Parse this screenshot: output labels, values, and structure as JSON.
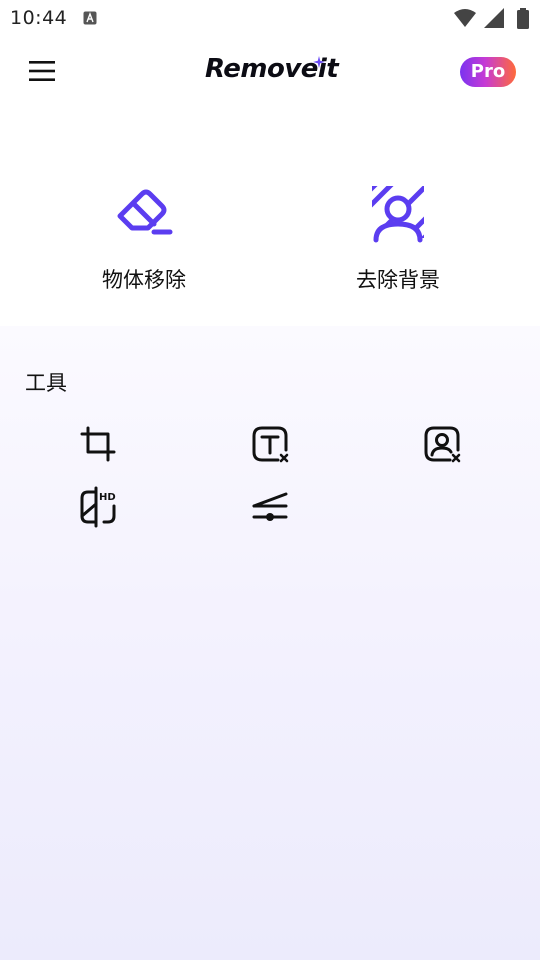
{
  "status_bar": {
    "time": "10:44",
    "icons": [
      "a-notification-icon",
      "wifi-icon",
      "signal-icon",
      "battery-icon"
    ]
  },
  "header": {
    "menu_icon": "hamburger-menu-icon",
    "logo_text": "Removeit",
    "pro_label": "Pro"
  },
  "features": [
    {
      "label": "物体移除",
      "icon": "eraser-icon"
    },
    {
      "label": "去除背景",
      "icon": "remove-background-icon"
    }
  ],
  "tools": {
    "title": "工具",
    "items": [
      {
        "icon": "crop-icon"
      },
      {
        "icon": "remove-text-icon"
      },
      {
        "icon": "remove-person-icon"
      },
      {
        "icon": "hd-enhance-icon"
      },
      {
        "icon": "adjust-slider-icon"
      }
    ]
  },
  "colors": {
    "accent": "#5b3df0",
    "pro_gradient_start": "#7b33f0",
    "pro_gradient_end": "#ff6a3a",
    "panel_background": "#f4f2fe"
  }
}
